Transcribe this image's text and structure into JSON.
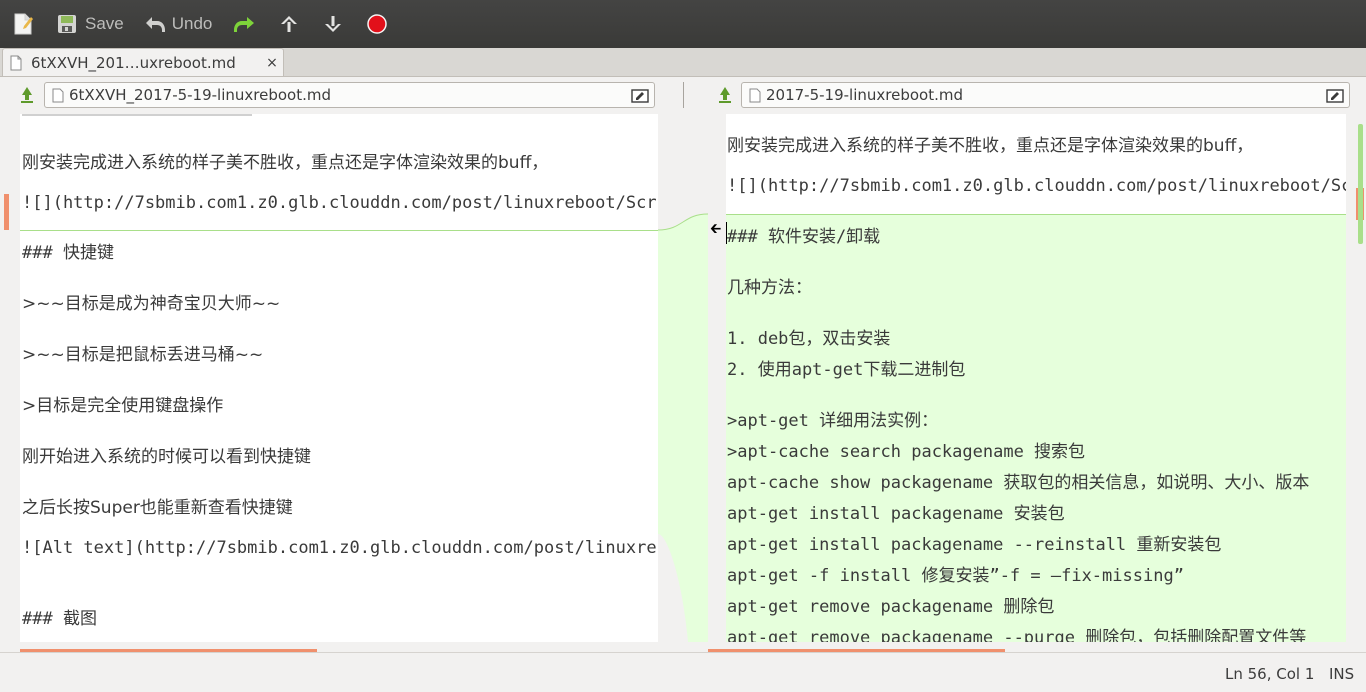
{
  "toolbar": {
    "new_label": "",
    "save_label": "Save",
    "undo_label": "Undo"
  },
  "tabs": [
    {
      "label": "6tXXVH_201…uxreboot.md",
      "close": "×"
    }
  ],
  "left_file": {
    "name": "6tXXVH_2017-5-19-linuxreboot.md"
  },
  "right_file": {
    "name": "2017-5-19-linuxreboot.md"
  },
  "left_lines": [
    "刚安装完成进入系统的样子美不胜收，重点还是字体渲染效果的buff，",
    "![](http://7sbmib.com1.z0.glb.clouddn.com/post/linuxreboot/Scr",
    "### 快捷键",
    ">~~目标是成为神奇宝贝大师~~",
    ">~~目标是把鼠标丢进马桶~~",
    ">目标是完全使用键盘操作",
    "刚开始进入系统的时候可以看到快捷键",
    "之后长按Super也能重新查看快捷键",
    "![Alt text](http://7sbmib.com1.z0.glb.clouddn.com/post/linuxre",
    "### 截图"
  ],
  "right_lines": [
    "刚安装完成进入系统的样子美不胜收，重点还是字体渲染效果的buff，",
    "![](http://7sbmib.com1.z0.glb.clouddn.com/post/linuxreboot/Scr",
    "### 软件安装/卸载",
    "几种方法：",
    "1. deb包，双击安装",
    "2. 使用apt-get下载二进制包",
    ">apt-get 详细用法实例：",
    ">apt-cache search packagename 搜索包",
    "apt-cache show packagename 获取包的相关信息，如说明、大小、版本",
    "apt-get install packagename 安装包",
    "apt-get install packagename --reinstall 重新安装包",
    "apt-get -f install 修复安装”-f = –fix-missing”",
    "apt-get remove packagename 删除包",
    "apt-get remove packagename --purge 删除包，包括删除配置文件等"
  ],
  "status": {
    "position": "Ln 56, Col 1",
    "mode": "INS"
  },
  "colors": {
    "toolbar_bg": "#3c3c3b",
    "diff_added": "#e6ffdc",
    "diff_border": "#a9df8a",
    "accent_orange": "#f0906d",
    "record_red": "#e2101a"
  }
}
